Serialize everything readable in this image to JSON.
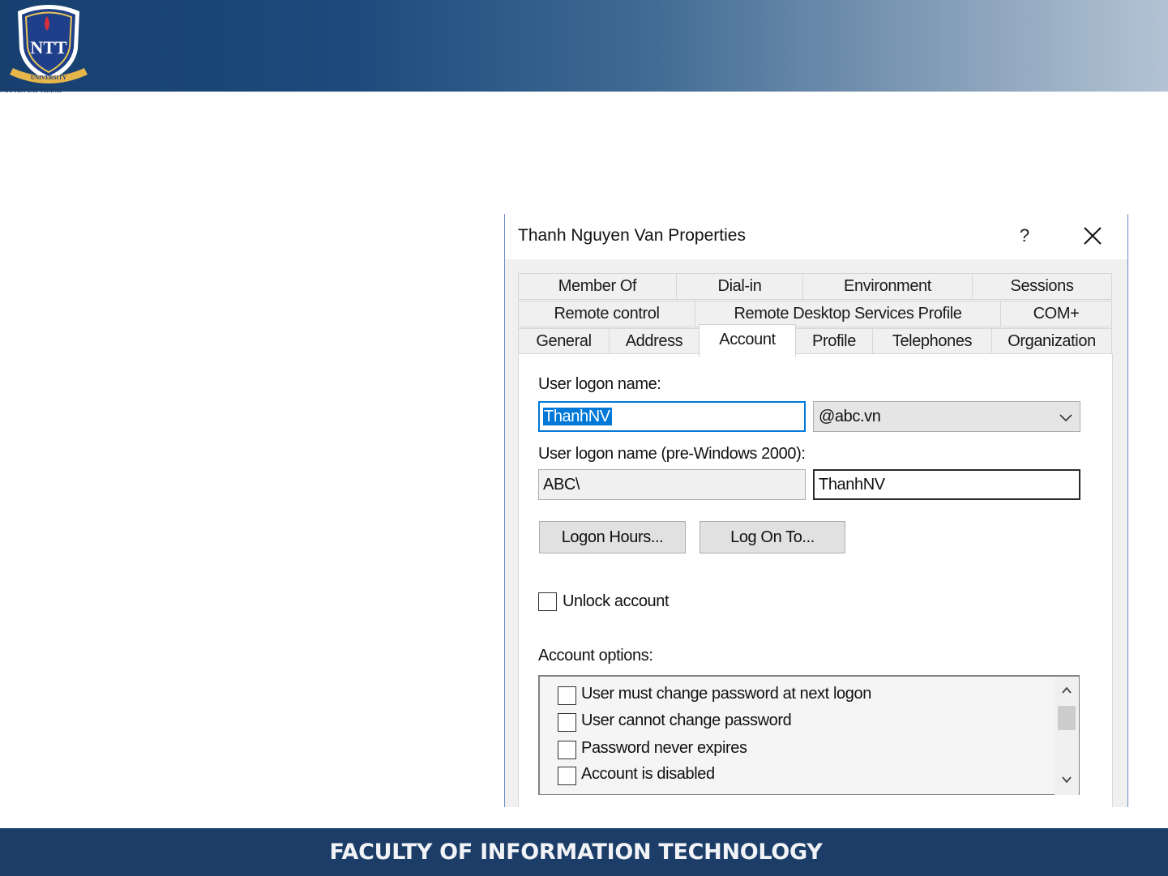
{
  "banner": {
    "logo_text": "NTT",
    "logo_ribbon": "UNIVERSITY",
    "logo_caption": "NGUYEN TAT THANH",
    "footer": "FACULTY OF INFORMATION TECHNOLOGY"
  },
  "dialog": {
    "title": "Thanh Nguyen Van Properties",
    "help_label": "?",
    "tabs_row1": [
      "Member Of",
      "Dial-in",
      "Environment",
      "Sessions"
    ],
    "tabs_row2": [
      "Remote control",
      "Remote Desktop Services Profile",
      "COM+"
    ],
    "tabs_row3": [
      "General",
      "Address",
      "Account",
      "Profile",
      "Telephones",
      "Organization"
    ],
    "active_tab": "Account",
    "account": {
      "logon_name_label": "User logon name:",
      "logon_name_value": "ThanhNV",
      "domain_value": "@abc.vn",
      "pre2000_label": "User logon name (pre-Windows 2000):",
      "pre2000_domain": "ABC\\",
      "pre2000_user": "ThanhNV",
      "logon_hours_button": "Logon Hours...",
      "log_on_to_button": "Log On To...",
      "unlock_label": "Unlock account",
      "options_label": "Account options:",
      "options": [
        "User must change password at next logon",
        "User cannot change password",
        "Password never expires",
        "Account is disabled"
      ]
    }
  },
  "colors": {
    "banner_dark": "#17406f",
    "footer_bg": "#1b3d68",
    "selection": "#0078d7"
  }
}
